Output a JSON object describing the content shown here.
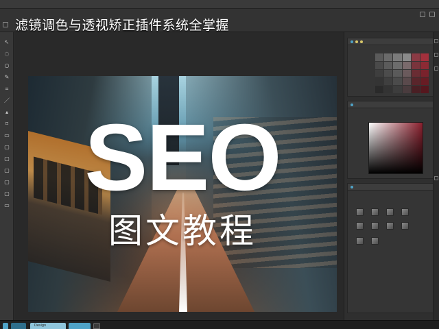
{
  "window": {
    "title": "滤镜调色与透视矫正插件系统全掌握"
  },
  "menu": {
    "items": [
      "",
      "",
      "",
      "",
      "",
      "",
      "",
      "",
      "",
      "",
      "",
      "",
      "",
      ""
    ]
  },
  "artwork": {
    "headline": "SEO",
    "subtitle": "图文教程"
  },
  "panels": {
    "swatches": {
      "tab_label": "",
      "side_labels": [
        "",
        "",
        ""
      ],
      "colors": [
        "#5a5a5a",
        "#6a6a6a",
        "#7b7b7b",
        "#8a8a8a",
        "#8b3a44",
        "#a3303c",
        "#4a4a4a",
        "#5b5b5b",
        "#6c6c6c",
        "#7a6a6c",
        "#7a343c",
        "#8c2a34",
        "#3e3e3e",
        "#4c4c4c",
        "#5a5a5a",
        "#6a5a5c",
        "#6a2c33",
        "#7a222c",
        "#343434",
        "#3f3f3f",
        "#4b4b4b",
        "#5a4a4c",
        "#5a252b",
        "#681c24",
        "#2a2a2a",
        "#333333",
        "#3d3d3d",
        "#4a3c3e",
        "#4a1f24",
        "#56171e"
      ]
    },
    "color": {
      "tab_label": "",
      "picker_label": "",
      "corner_badge": ""
    },
    "adjustments": {
      "tab_label": "",
      "sub_label": ""
    }
  },
  "status": {
    "doc_tab_label": "Design"
  },
  "accent": "#4fa3c7"
}
